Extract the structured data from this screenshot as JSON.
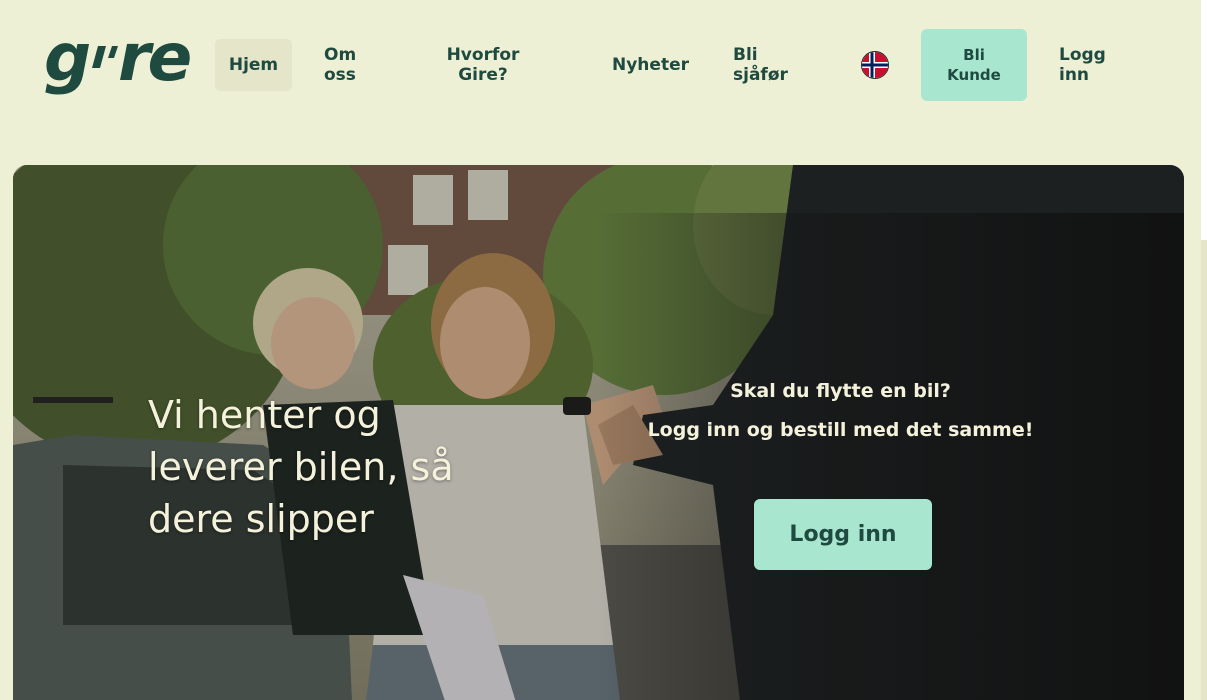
{
  "header": {
    "logo_text": "gire",
    "nav": {
      "home": "Hjem",
      "about": "Om oss",
      "why": "Hvorfor Gire?",
      "news": "Nyheter",
      "driver": "Bli sjåfør",
      "customer_button": "Bli Kunde",
      "login": "Logg inn"
    },
    "language_flag": "norway-flag-icon"
  },
  "hero": {
    "headline": "Vi henter og leverer bilen, så dere slipper",
    "question": "Skal du flytte en bil?",
    "subtext": "Logg inn og bestill med det samme!",
    "login_button": "Logg inn"
  },
  "colors": {
    "background": "#EEF0D6",
    "brand_dark": "#1F4A3F",
    "accent_mint": "#A8E6CF",
    "hero_text": "#F5F2DC"
  }
}
